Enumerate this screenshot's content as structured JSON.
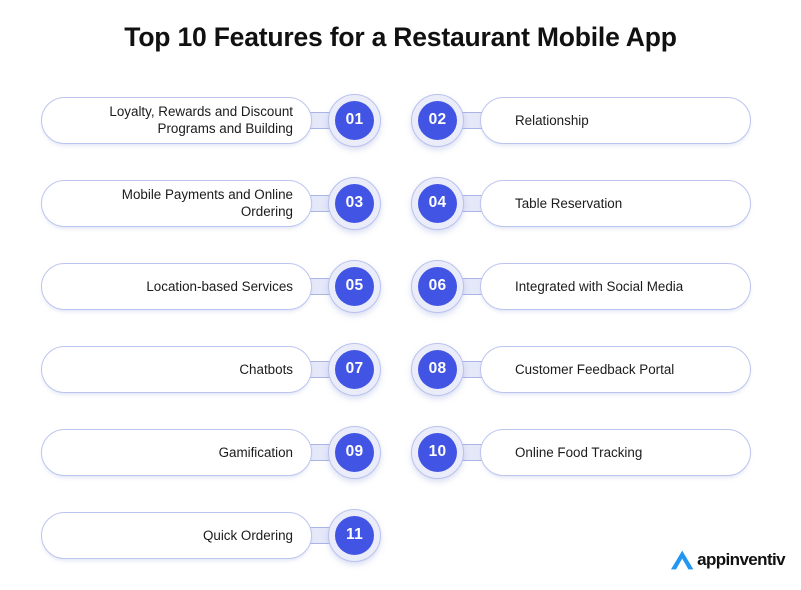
{
  "title": "Top 10 Features for a Restaurant Mobile App",
  "colors": {
    "badge_blue": "#4154e3",
    "ring_lavender": "#eaecf9",
    "pill_border": "#bcc5ef",
    "connector": "#e5e8f8",
    "logo_blue": "#2196f3",
    "text": "#1b1b1b"
  },
  "rows": [
    {
      "left": {
        "number": "01",
        "label_line1": "Loyalty, Rewards and Discount",
        "label_line2": "Programs and Building"
      },
      "right": {
        "number": "02",
        "label_line1": "Relationship",
        "label_line2": ""
      }
    },
    {
      "left": {
        "number": "03",
        "label_line1": "Mobile Payments and Online",
        "label_line2": "Ordering"
      },
      "right": {
        "number": "04",
        "label_line1": "Table Reservation",
        "label_line2": ""
      }
    },
    {
      "left": {
        "number": "05",
        "label_line1": "Location-based Services",
        "label_line2": ""
      },
      "right": {
        "number": "06",
        "label_line1": "Integrated with Social Media",
        "label_line2": ""
      }
    },
    {
      "left": {
        "number": "07",
        "label_line1": "Chatbots",
        "label_line2": ""
      },
      "right": {
        "number": "08",
        "label_line1": "Customer Feedback Portal",
        "label_line2": ""
      }
    },
    {
      "left": {
        "number": "09",
        "label_line1": "Gamification",
        "label_line2": ""
      },
      "right": {
        "number": "10",
        "label_line1": "Online Food Tracking",
        "label_line2": ""
      }
    },
    {
      "left": {
        "number": "11",
        "label_line1": "Quick Ordering",
        "label_line2": ""
      },
      "right": null
    }
  ],
  "logo": {
    "mark": "appinventiv-arrow-logo",
    "text": "appinventiv"
  }
}
